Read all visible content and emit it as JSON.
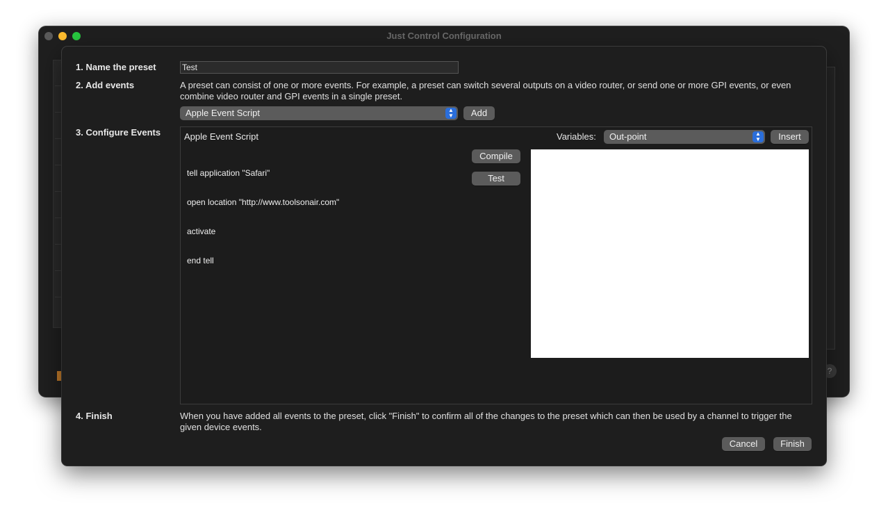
{
  "window": {
    "title": "Just Control Configuration",
    "help_label": "?"
  },
  "steps": {
    "name": {
      "label": "1. Name the preset",
      "value": "Test"
    },
    "add": {
      "label": "2. Add events",
      "description": "A preset can consist of one or more events. For example, a preset can switch several outputs on a video router, or send one or more GPI events, or even combine video router and GPI events in a single preset.",
      "event_type": "Apple Event Script",
      "add_label": "Add"
    },
    "configure": {
      "label": "3. Configure Events",
      "event_title": "Apple Event Script",
      "variables_label": "Variables:",
      "variable_selected": "Out-point",
      "insert_label": "Insert",
      "script_lines": [
        "tell application \"Safari\"",
        "open location \"http://www.toolsonair.com\"",
        "activate",
        "end tell"
      ],
      "compile_label": "Compile",
      "test_label": "Test"
    },
    "finish": {
      "label": "4. Finish",
      "description": "When you have added all events to the preset, click \"Finish\" to confirm all of the changes to the preset which can then be used by a channel to trigger the given device events.",
      "cancel_label": "Cancel",
      "finish_label": "Finish"
    }
  },
  "colors": {
    "accent": "#2a6edb",
    "sheet_bg": "#1e1e1e",
    "button_bg": "#5b5b5b"
  }
}
